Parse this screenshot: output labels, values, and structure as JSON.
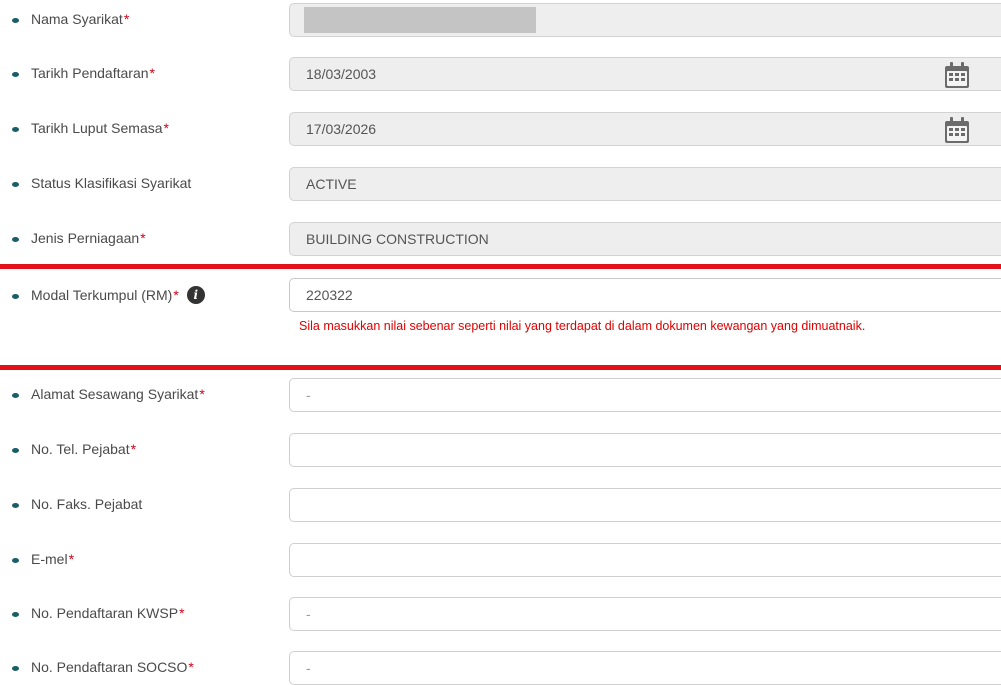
{
  "form": {
    "fields": [
      {
        "label": "Nama Syarikat",
        "required": "*",
        "value": "",
        "redacted": true,
        "readonly": true
      },
      {
        "label": "Tarikh Pendaftaran",
        "required": "*",
        "value": "18/03/2003",
        "readonly": true,
        "icon": "calendar-icon"
      },
      {
        "label": "Tarikh Luput Semasa",
        "required": "*",
        "value": "17/03/2026",
        "readonly": true,
        "icon": "calendar-icon"
      },
      {
        "label": "Status Klasifikasi Syarikat",
        "required": "",
        "value": "ACTIVE",
        "readonly": true
      },
      {
        "label": "Jenis Perniagaan",
        "required": "*",
        "value": "BUILDING CONSTRUCTION",
        "readonly": true
      },
      {
        "label": "Modal Terkumpul (RM)",
        "required": "*",
        "value": "220322",
        "readonly": false,
        "icon": "info-icon",
        "icon_glyph": "i"
      },
      {
        "label": "Alamat Sesawang Syarikat",
        "required": "*",
        "value": "-",
        "readonly": false
      },
      {
        "label": "No. Tel. Pejabat",
        "required": "*",
        "value": "",
        "readonly": false
      },
      {
        "label": "No. Faks. Pejabat",
        "required": "",
        "value": "",
        "readonly": false
      },
      {
        "label": "E-mel",
        "required": "*",
        "value": "",
        "readonly": false
      },
      {
        "label": "No. Pendaftaran KWSP",
        "required": "*",
        "value": "-",
        "readonly": false
      },
      {
        "label": "No. Pendaftaran SOCSO",
        "required": "*",
        "value": "-",
        "readonly": false
      }
    ],
    "modal_error": "Sila masukkan nilai sebenar seperti nilai yang terdapat di dalam dokumen kewangan yang dimuatnaik."
  },
  "colors": {
    "required": "#d0021b",
    "error_text": "#e00000",
    "highlight_line": "#e3101a",
    "bullet": "#1b5e68",
    "readonly_bg": "#eeeeee"
  }
}
